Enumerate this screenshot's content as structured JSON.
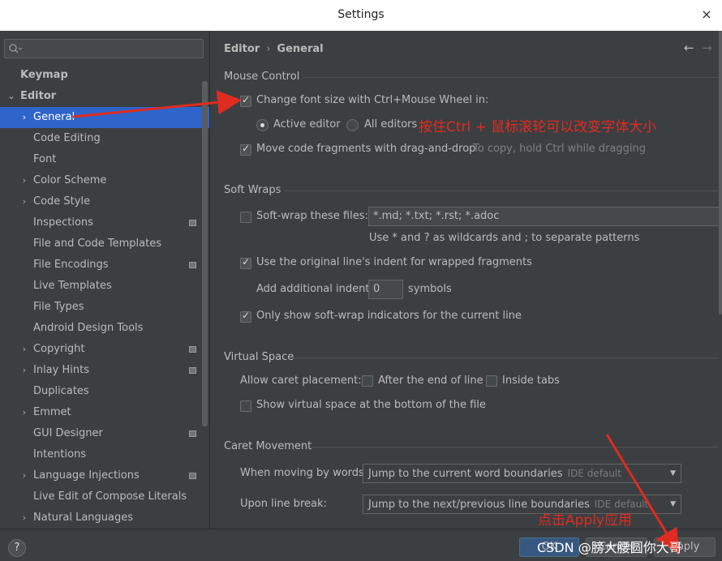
{
  "window": {
    "title": "Settings",
    "close_icon": "×"
  },
  "search": {
    "placeholder": ""
  },
  "tree": {
    "keymap": "Keymap",
    "editor": "Editor",
    "items": [
      {
        "label": "General"
      },
      {
        "label": "Code Editing"
      },
      {
        "label": "Font"
      },
      {
        "label": "Color Scheme"
      },
      {
        "label": "Code Style"
      },
      {
        "label": "Inspections"
      },
      {
        "label": "File and Code Templates"
      },
      {
        "label": "File Encodings"
      },
      {
        "label": "Live Templates"
      },
      {
        "label": "File Types"
      },
      {
        "label": "Android Design Tools"
      },
      {
        "label": "Copyright"
      },
      {
        "label": "Inlay Hints"
      },
      {
        "label": "Duplicates"
      },
      {
        "label": "Emmet"
      },
      {
        "label": "GUI Designer"
      },
      {
        "label": "Intentions"
      },
      {
        "label": "Language Injections"
      },
      {
        "label": "Live Edit of Compose Literals"
      },
      {
        "label": "Natural Languages"
      }
    ]
  },
  "breadcrumb": {
    "parent": "Editor",
    "sep": "›",
    "current": "General"
  },
  "nav": {
    "back": "←",
    "forward": "→"
  },
  "mouse_control": {
    "header": "Mouse Control",
    "change_font": "Change font size with Ctrl+Mouse Wheel in:",
    "active_editor": "Active editor",
    "all_editors": "All editors",
    "move_fragments": "Move code fragments with drag-and-drop",
    "move_hint": "To copy, hold Ctrl while dragging"
  },
  "soft_wraps": {
    "header": "Soft Wraps",
    "soft_wrap_files": "Soft-wrap these files:",
    "files_value": "*.md; *.txt; *.rst; *.adoc",
    "files_hint": "Use * and ? as wildcards and ; to separate patterns",
    "original_indent": "Use the original line's indent for wrapped fragments",
    "additional_indent": "Add additional indent:",
    "indent_value": "0",
    "symbols": "symbols",
    "only_show": "Only show soft-wrap indicators for the current line"
  },
  "virtual_space": {
    "header": "Virtual Space",
    "allow_caret": "Allow caret placement:",
    "after_end": "After the end of line",
    "inside_tabs": "Inside tabs",
    "show_virtual": "Show virtual space at the bottom of the file"
  },
  "caret_movement": {
    "header": "Caret Movement",
    "moving_words_label": "When moving by words:",
    "moving_words_value": "Jump to the current word boundaries",
    "moving_words_default": "IDE default",
    "line_break_label": "Upon line break:",
    "line_break_value": "Jump to the next/previous line boundaries",
    "line_break_default": "IDE default",
    "dropdown_icon": "▼"
  },
  "footer": {
    "help": "?",
    "ok": "OK",
    "cancel": "Cancel",
    "apply": "Apply"
  },
  "annotations": {
    "ctrl_tip": "按住Ctrl + 鼠标滚轮可以改变字体大小",
    "apply_tip": "点击Apply应用",
    "watermark": "CSDN @膀大腰圆你大哥"
  },
  "colors": {
    "selection": "#2f65ca",
    "annotation": "#e02b20",
    "primary_button": "#365880"
  }
}
